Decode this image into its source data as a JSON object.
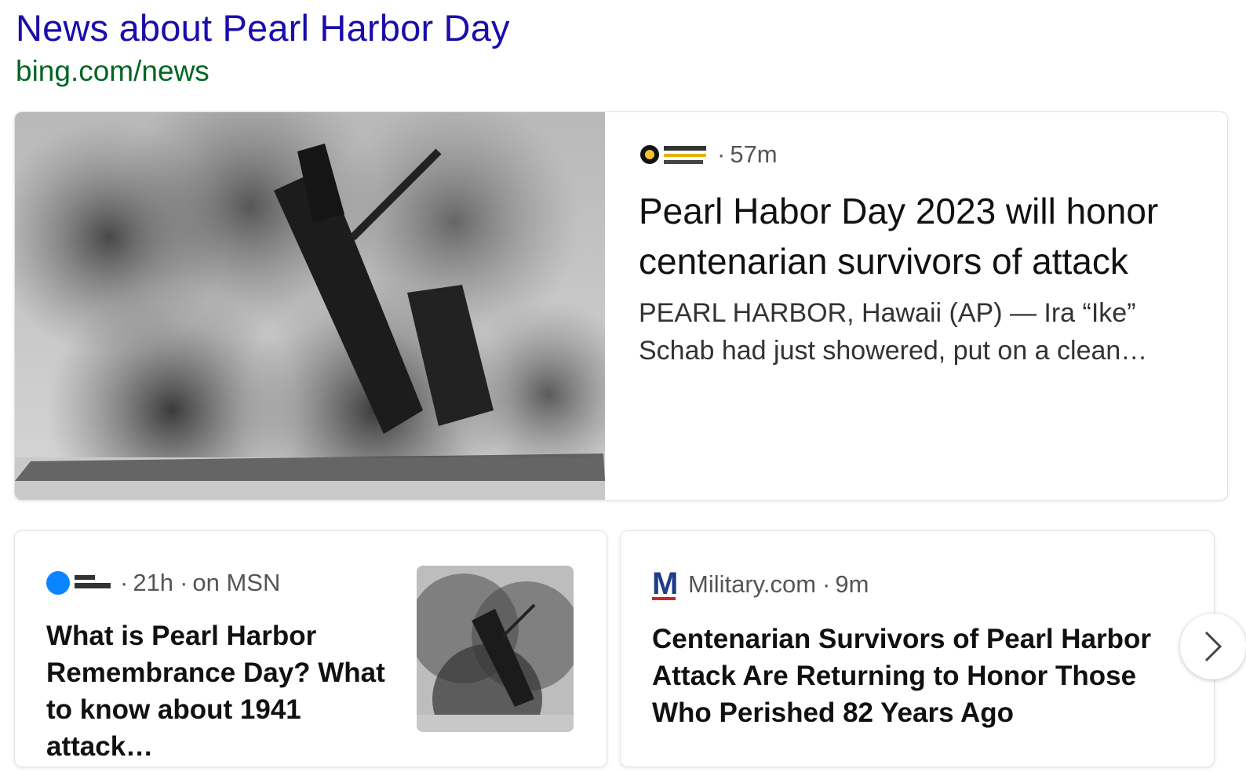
{
  "header": {
    "title": "News about Pearl Harbor Day",
    "url": "bing.com/news"
  },
  "featured": {
    "source_logo": "PennLive Patriot-News",
    "time": "57m",
    "title": "Pearl Habor Day 2023 will honor centenarian survivors of attack",
    "snippet": "PEARL HARBOR, Hawaii (AP) — Ira “Ike” Schab had just showered, put on a clean…"
  },
  "articles": [
    {
      "source_logo": "USA TODAY",
      "time": "21h",
      "via": "on MSN",
      "title": "What is Pearl Harbor Remembrance Day? What to know about 1941 attack…"
    },
    {
      "source_logo": "M",
      "source": "Military.com",
      "time": "9m",
      "title": "Centenarian Survivors of Pearl Harbor Attack Are Returning to Honor Those Who Perished 82 Years Ago"
    }
  ],
  "icons": {
    "next": "chevron-right-icon"
  },
  "colors": {
    "title_link": "#1a0dab",
    "url": "#006621",
    "usa_today_blue": "#0a84ff",
    "military_blue": "#1f3c88",
    "military_red": "#c62828"
  }
}
